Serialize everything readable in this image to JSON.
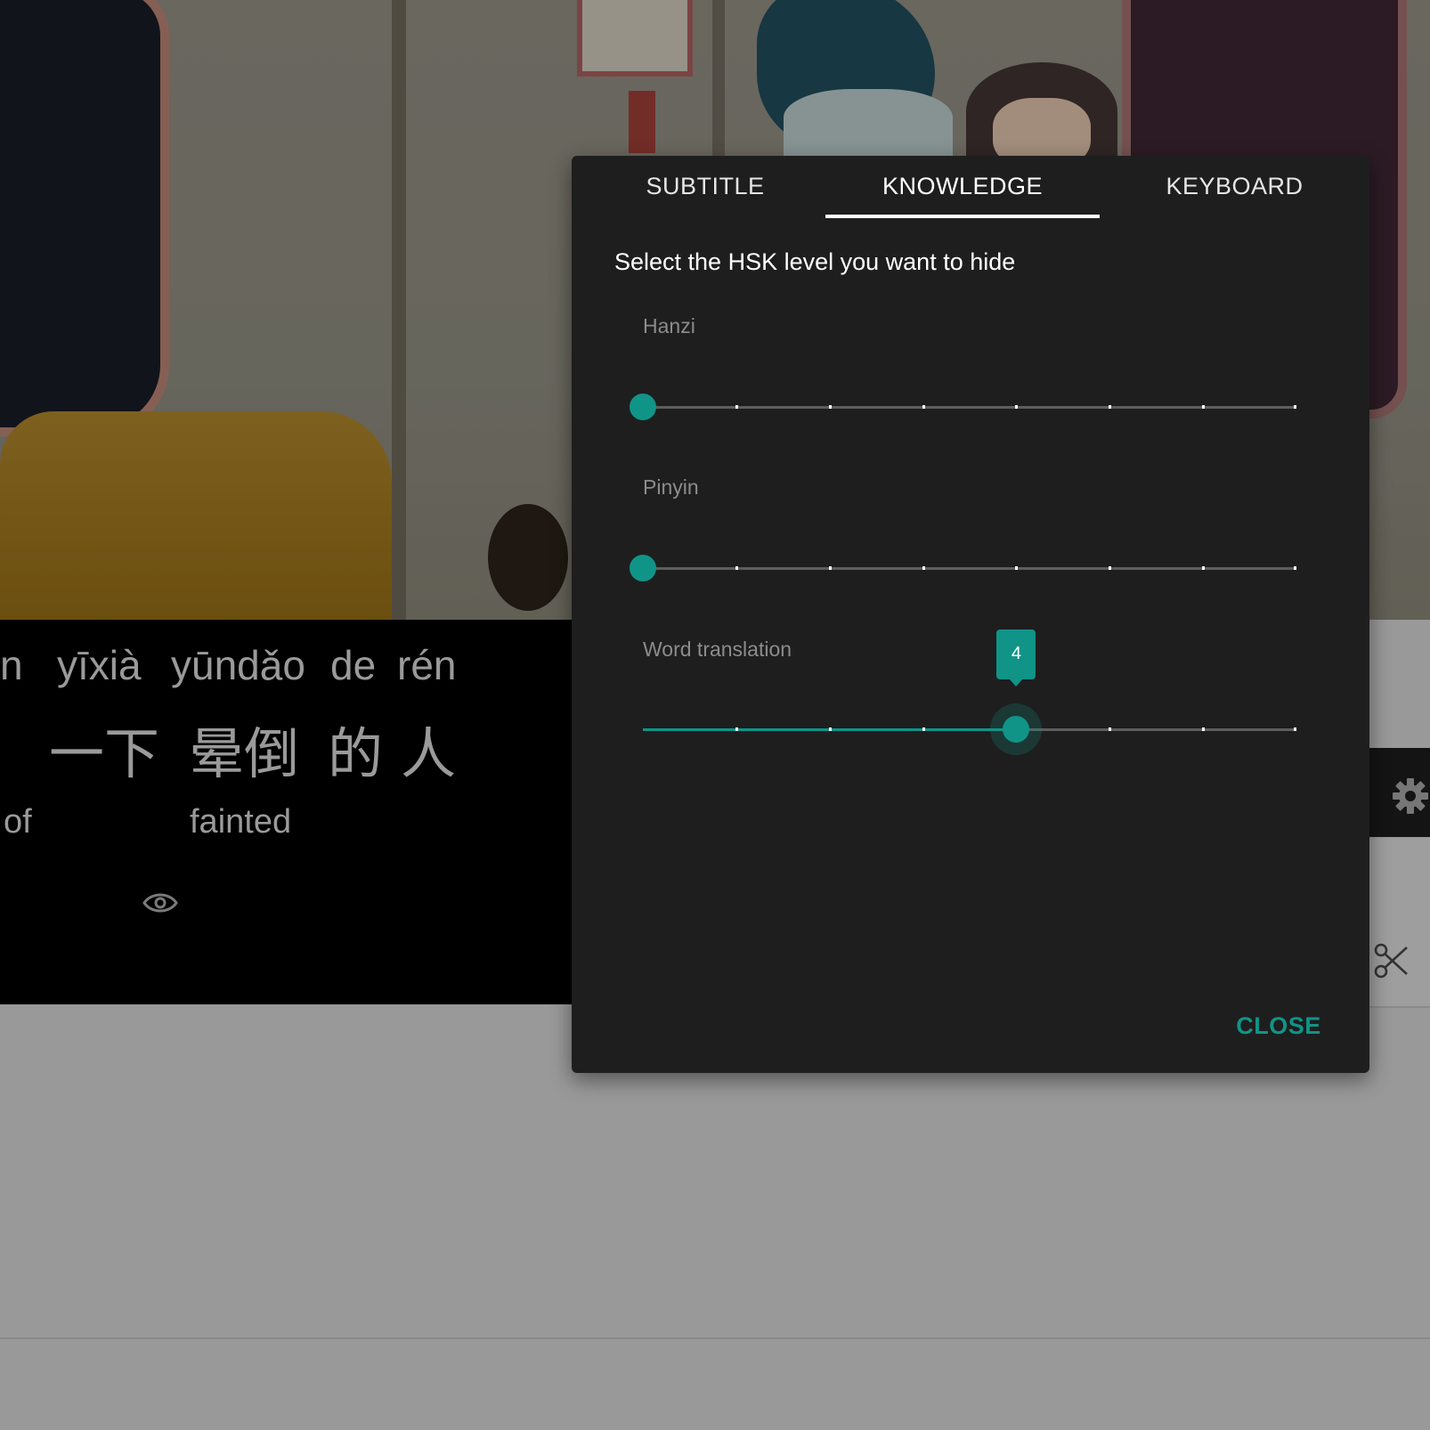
{
  "dialog": {
    "tabs": [
      {
        "label": "SUBTITLE",
        "active": false
      },
      {
        "label": "KNOWLEDGE",
        "active": true
      },
      {
        "label": "KEYBOARD",
        "active": false
      }
    ],
    "heading": "Select the HSK level you want to hide",
    "sliders": [
      {
        "label": "Hanzi",
        "value": 0,
        "max": 7
      },
      {
        "label": "Pinyin",
        "value": 0,
        "max": 7
      },
      {
        "label": "Word translation",
        "value": 4,
        "max": 7,
        "bubble": "4"
      }
    ],
    "close_label": "CLOSE",
    "accent_color": "#109488"
  },
  "subtitles": {
    "pinyin": [
      "n",
      "yīxià",
      "yūndǎo",
      "de",
      "rén"
    ],
    "hanzi": [
      "一下",
      "晕倒",
      "的",
      "人"
    ],
    "translations": [
      "of",
      "fainted"
    ]
  },
  "icons": {
    "eye": "eye-icon",
    "gear": "gear-icon",
    "scissors": "scissors-icon"
  }
}
